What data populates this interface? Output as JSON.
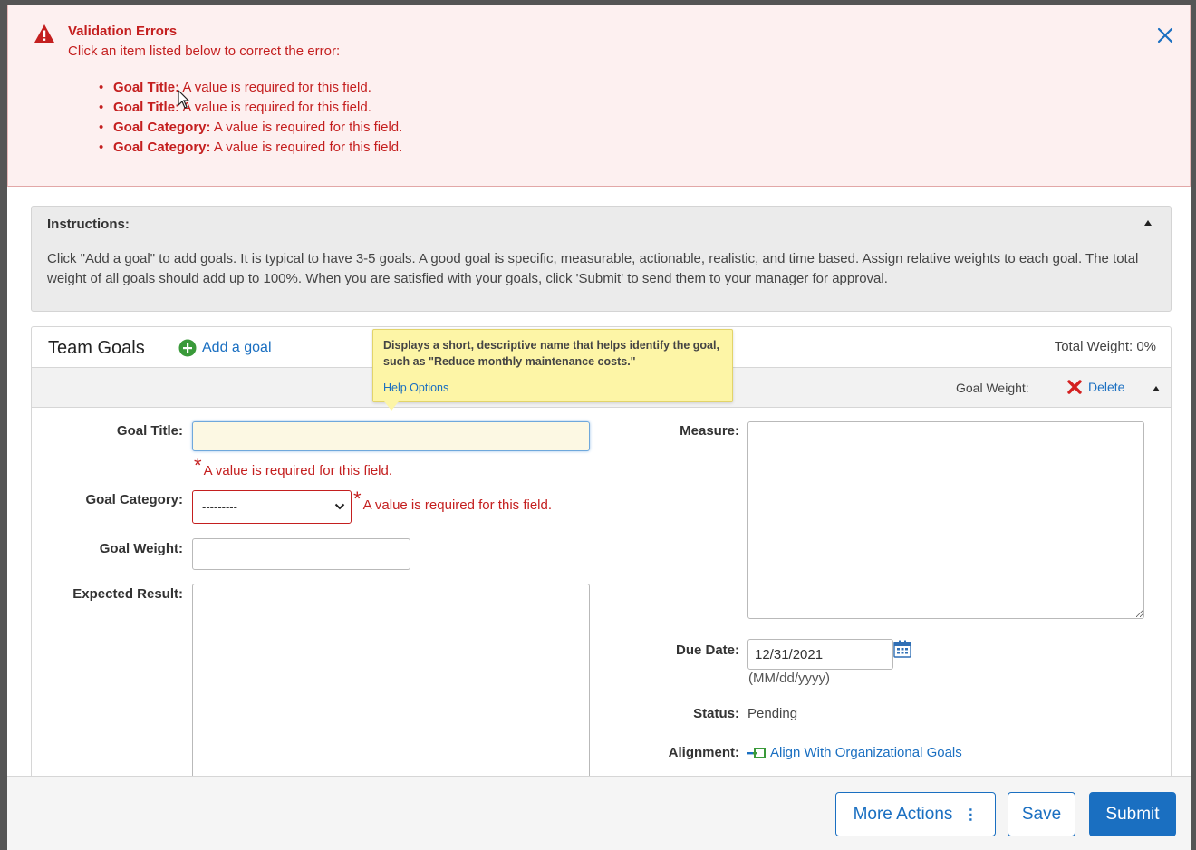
{
  "validation": {
    "title": "Validation Errors",
    "subtitle": "Click an item listed below to correct the error:",
    "errors": [
      {
        "field": "Goal Title:",
        "message": " A value is required for this field."
      },
      {
        "field": "Goal Title:",
        "message": " A value is required for this field."
      },
      {
        "field": "Goal Category:",
        "message": " A value is required for this field."
      },
      {
        "field": "Goal Category:",
        "message": " A value is required for this field."
      }
    ],
    "close_icon": "close-x-icon"
  },
  "instructions": {
    "title": "Instructions:",
    "text": "Click \"Add a goal\" to add goals. It is typical to have 3-5 goals. A good goal is specific, measurable, actionable, realistic, and time based. Assign relative weights to each goal. The total weight of all goals should add up to 100%. When you are satisfied with your goals, click 'Submit' to send them to your manager for approval."
  },
  "goals": {
    "title": "Team Goals",
    "add_label": "Add a goal",
    "total_weight": "Total Weight: 0%",
    "goal_weight_label": "Goal Weight:",
    "delete_label": "Delete",
    "fields": {
      "goal_title_label": "Goal Title:",
      "goal_title_value": "",
      "required_msg": "A value is required for this field.",
      "goal_category_label": "Goal Category:",
      "goal_category_value": "---------",
      "goal_weight_label": "Goal Weight:",
      "goal_weight_value": "",
      "expected_result_label": "Expected Result:",
      "measure_label": "Measure:",
      "due_date_label": "Due Date:",
      "due_date_value": "12/31/2021",
      "due_date_hint": "(MM/dd/yyyy)",
      "status_label": "Status:",
      "status_value": "Pending",
      "alignment_label": "Alignment:",
      "alignment_link": "Align With Organizational Goals"
    }
  },
  "tooltip": {
    "text": "Displays a short, descriptive name that helps identify the goal, such as \"Reduce monthly maintenance costs.\"",
    "link": "Help Options"
  },
  "footer": {
    "more_actions": "More Actions",
    "save": "Save",
    "submit": "Submit"
  },
  "colors": {
    "error": "#c41f1f",
    "link": "#1a6fc1",
    "tooltip_bg": "#fdf5a6",
    "banner_bg": "#fdf0f0"
  }
}
